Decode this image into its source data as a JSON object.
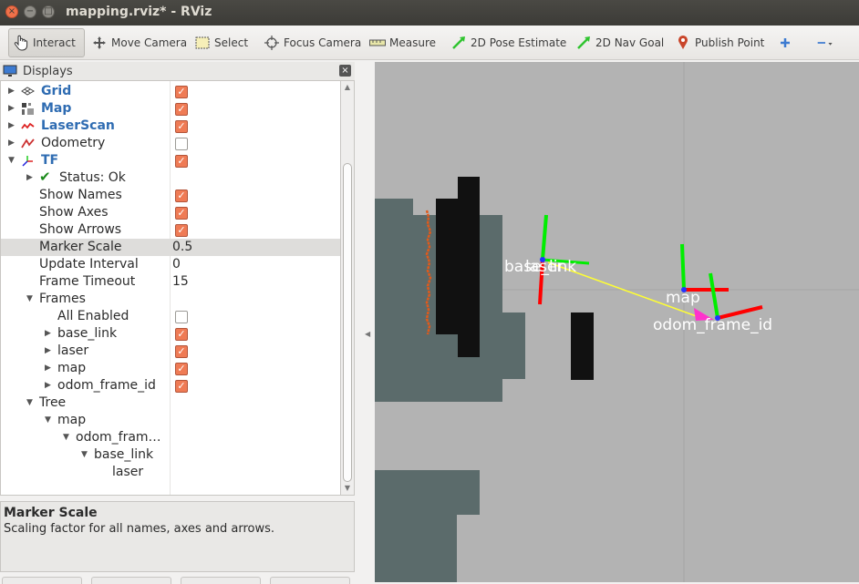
{
  "window": {
    "title": "mapping.rviz* - RViz",
    "controls": {
      "close": "×",
      "minimize": "−",
      "maximize": "□"
    }
  },
  "toolbar": {
    "tools": [
      {
        "label": "Interact",
        "icon": "hand-pointer-icon",
        "active": true
      },
      {
        "label": "Move Camera",
        "icon": "move-camera-icon"
      },
      {
        "label": "Select",
        "icon": "select-box-icon"
      },
      {
        "label": "Focus Camera",
        "icon": "focus-crosshair-icon"
      },
      {
        "label": "Measure",
        "icon": "ruler-icon"
      },
      {
        "label": "2D Pose Estimate",
        "icon": "green-arrow-icon"
      },
      {
        "label": "2D Nav Goal",
        "icon": "green-arrow-icon"
      },
      {
        "label": "Publish Point",
        "icon": "map-pin-icon"
      },
      {
        "label": "",
        "icon": "plus-icon"
      },
      {
        "label": "",
        "icon": "minus-dropdown-icon"
      }
    ]
  },
  "displays": {
    "title": "Displays",
    "close": "×",
    "rows": [
      {
        "label": "Grid",
        "blue": true,
        "checked": true,
        "icon": "grid-icon"
      },
      {
        "label": "Map",
        "blue": true,
        "checked": true,
        "icon": "map-icon"
      },
      {
        "label": "LaserScan",
        "blue": true,
        "checked": true,
        "icon": "laserscan-icon"
      },
      {
        "label": "Odometry",
        "blue": false,
        "checked": false,
        "icon": "odometry-icon"
      },
      {
        "label": "TF",
        "blue": true,
        "checked": true,
        "icon": "tf-icon"
      },
      {
        "label": "Status: Ok",
        "icon": "checkmark-icon"
      },
      {
        "label": "Show Names",
        "checked": true
      },
      {
        "label": "Show Axes",
        "checked": true
      },
      {
        "label": "Show Arrows",
        "checked": true
      },
      {
        "label": "Marker Scale",
        "value": "0.5",
        "selected": true
      },
      {
        "label": "Update Interval",
        "value": "0"
      },
      {
        "label": "Frame Timeout",
        "value": "15"
      },
      {
        "label": "Frames"
      },
      {
        "label": "All Enabled",
        "checked": false
      },
      {
        "label": "base_link",
        "checked": true
      },
      {
        "label": "laser",
        "checked": true
      },
      {
        "label": "map",
        "checked": true
      },
      {
        "label": "odom_frame_id",
        "checked": true
      },
      {
        "label": "Tree"
      },
      {
        "label": "map"
      },
      {
        "label": "odom_fram…"
      },
      {
        "label": "base_link"
      },
      {
        "label": "laser"
      }
    ]
  },
  "description": {
    "title": "Marker Scale",
    "text": "Scaling factor for all names, axes and arrows."
  },
  "viewport": {
    "frame_labels": [
      "base_link",
      "laser",
      "map",
      "odom_frame_id"
    ],
    "colors": {
      "background": "#b3b3b3",
      "map_known": "#5b6b6b",
      "map_occupied": "#111111",
      "laser_points": "#e05a1b",
      "axis_x": "#ff0000",
      "axis_y": "#00ff00",
      "axis_z": "#0000ff",
      "tf_arrow": "#ffff33",
      "tf_arrowhead": "#ff33cc"
    }
  }
}
